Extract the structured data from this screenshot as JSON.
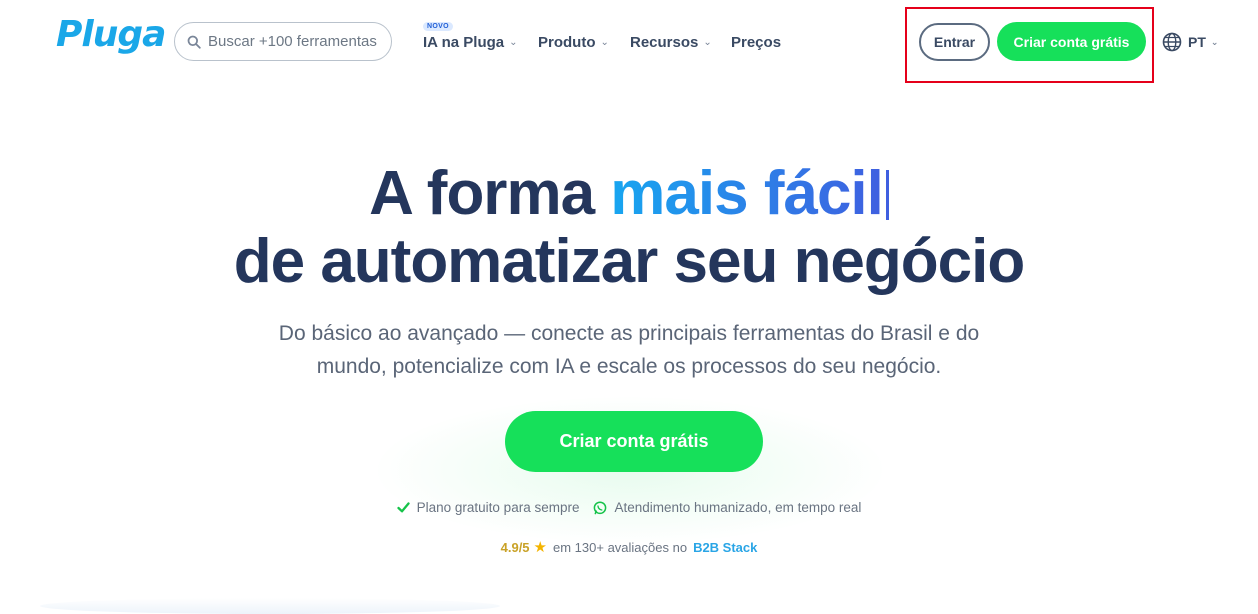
{
  "header": {
    "logo_text": "Pluga",
    "search_placeholder": "Buscar +100 ferramentas",
    "nav": [
      {
        "label": "IA na Pluga",
        "badge": "NOVO"
      },
      {
        "label": "Produto"
      },
      {
        "label": "Recursos"
      },
      {
        "label": "Preços"
      }
    ],
    "login_label": "Entrar",
    "signup_label": "Criar conta grátis",
    "language": "PT"
  },
  "hero": {
    "title_prefix": "A forma ",
    "title_accent": "mais fácil",
    "title_line2": "de automatizar seu negócio",
    "subtitle": "Do básico ao avançado — conecte as principais ferramentas do Brasil e do mundo, potencialize com IA e escale os processos do seu negócio.",
    "cta_label": "Criar conta grátis",
    "features": [
      {
        "icon": "check-icon",
        "text": "Plano gratuito para sempre"
      },
      {
        "icon": "whatsapp-icon",
        "text": "Atendimento humanizado, em tempo real"
      }
    ],
    "rating": {
      "score": "4.9/5",
      "text": "em 130+ avaliações no",
      "source": "B2B Stack"
    }
  },
  "colors": {
    "primary_green": "#16e05a",
    "brand_blue": "#1aa7e8",
    "heading_navy": "#24365c",
    "highlight_red": "#e5001a"
  }
}
